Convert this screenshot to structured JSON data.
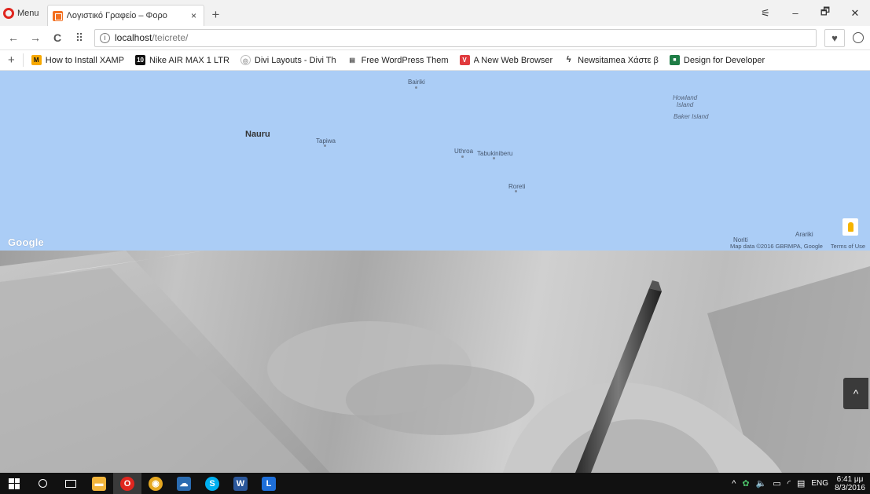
{
  "browser": {
    "menu_label": "Menu",
    "tab_title": "Λογιστικό Γραφείο – Φορο",
    "tab_close": "×",
    "new_tab": "+",
    "window_controls": {
      "menu": "⚟",
      "minimize": "–",
      "restore": "🗗",
      "close": "✕"
    },
    "nav": {
      "back": "←",
      "forward": "→",
      "reload": "C",
      "speed_dial": "⠿"
    },
    "url_host": "localhost",
    "url_path": "/teicrete/",
    "heart": "♥",
    "bookmarks": [
      {
        "label": "How to Install XAMP",
        "icon_text": "M",
        "color": "#f7a800"
      },
      {
        "label": "Nike AIR MAX 1 LTR",
        "icon_text": "10",
        "color": "#111111"
      },
      {
        "label": "Divi Layouts - Divi Th",
        "icon_text": "◎",
        "color": "#9a9a9a"
      },
      {
        "label": "Free WordPress Them",
        "icon_text": "▤",
        "color": "#555555"
      },
      {
        "label": "A New Web Browser",
        "icon_text": "V",
        "color": "#e03a3e"
      },
      {
        "label": "Newsitamea Χάστε β",
        "icon_text": "ϟ",
        "color": "#333333"
      },
      {
        "label": "Design for Developer",
        "icon_text": "■",
        "color": "#1f7d46"
      }
    ],
    "bookmarks_add": "+"
  },
  "map": {
    "background_color": "#abcdf6",
    "labels": {
      "bairiki": "Bairiki",
      "howland": "Howland\nIsland",
      "baker": "Baker Island",
      "nauru": "Nauru",
      "tapiwa": "Tapiwa",
      "uthroa": "Uthroa",
      "tabukiniberu": "Tabukiniberu",
      "roreti": "Roreti",
      "noriti": "Noriti",
      "arariki": "Arariki"
    },
    "logo": "Google",
    "attribution": "Map data ©2016 GBRMPA, Google",
    "terms": "Terms of Use"
  },
  "hero": {
    "scroll_top": "^"
  },
  "taskbar": {
    "apps": [
      {
        "name": "file-explorer",
        "color": "#f3b53b",
        "glyph": "▬"
      },
      {
        "name": "opera",
        "color": "#e0261f",
        "glyph": "O"
      },
      {
        "name": "chrome",
        "color": "#e6a821",
        "glyph": "◉"
      },
      {
        "name": "app-cloud",
        "color": "#2a6bb0",
        "glyph": "☁"
      },
      {
        "name": "skype",
        "color": "#00aff0",
        "glyph": "S"
      },
      {
        "name": "word",
        "color": "#2b579a",
        "glyph": "W"
      },
      {
        "name": "app-l",
        "color": "#1e6fd9",
        "glyph": "L"
      }
    ],
    "tray": {
      "chevron": "^",
      "lang": "ENG",
      "time": "6:41 μμ",
      "date": "8/3/2016"
    }
  }
}
